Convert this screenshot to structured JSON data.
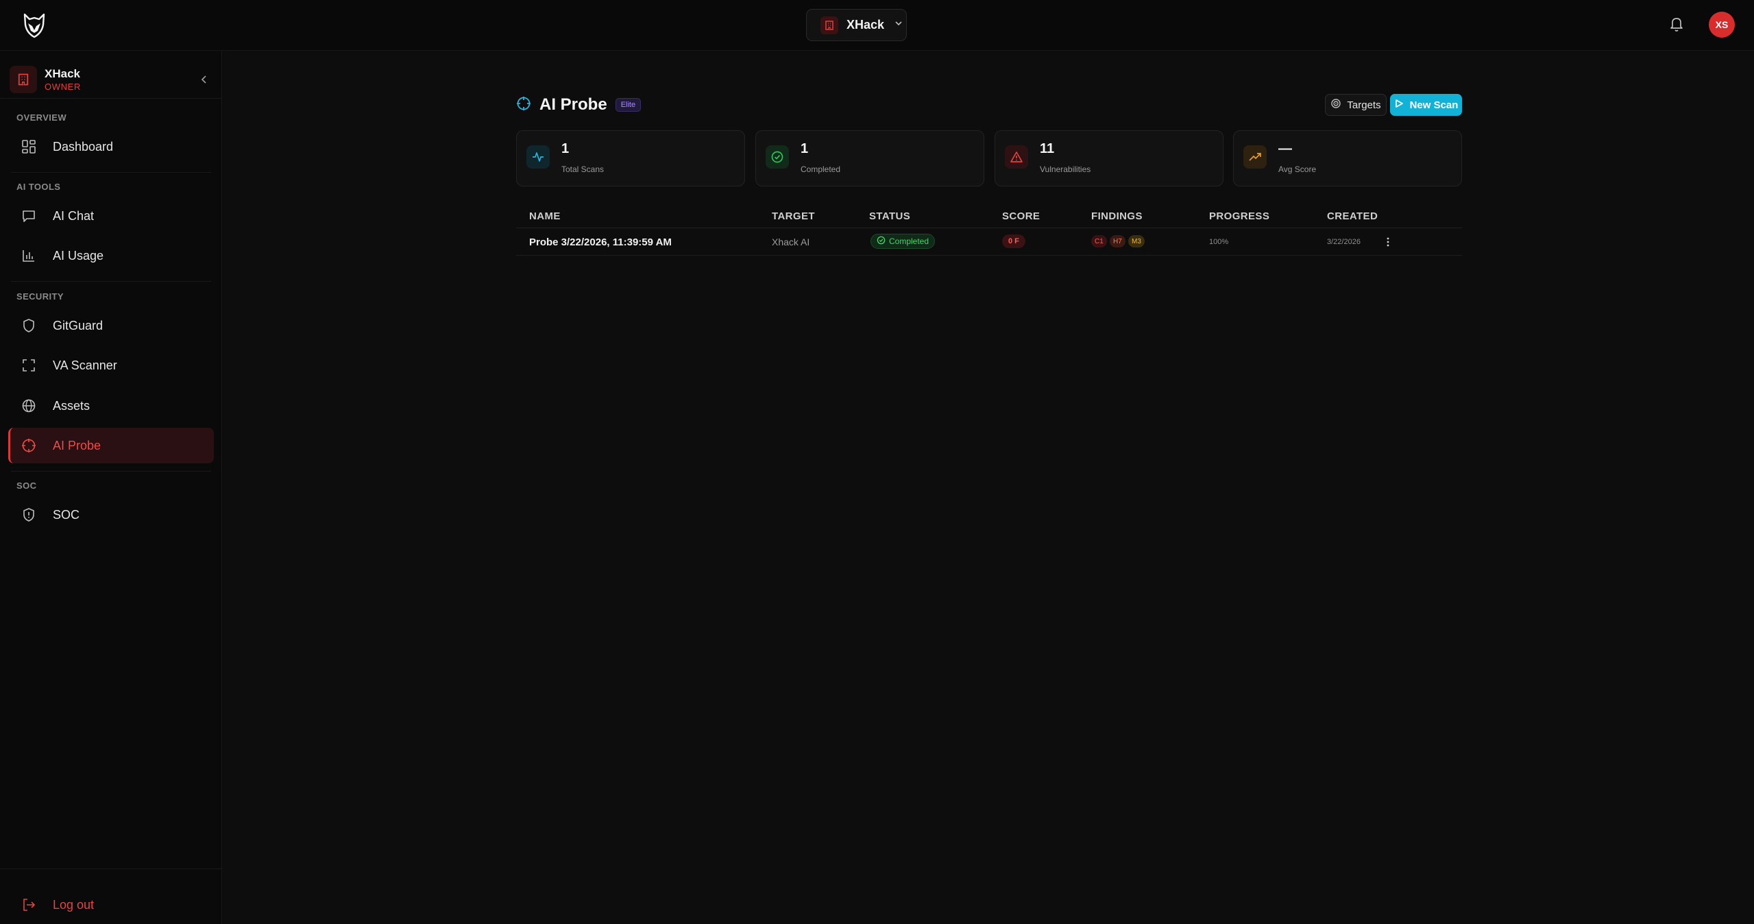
{
  "header": {
    "org_switcher_label": "XHack",
    "avatar_initials": "XS"
  },
  "sidebar": {
    "workspace_name": "XHack",
    "workspace_role": "OWNER",
    "sections": {
      "overview": "OVERVIEW",
      "ai_tools": "AI TOOLS",
      "security": "SECURITY",
      "soc": "SOC"
    },
    "items": {
      "dashboard": "Dashboard",
      "ai_chat": "AI Chat",
      "ai_usage": "AI Usage",
      "gitguard": "GitGuard",
      "va_scanner": "VA Scanner",
      "assets": "Assets",
      "ai_probe": "AI Probe",
      "soc": "SOC"
    },
    "logout_label": "Log out"
  },
  "page": {
    "title": "AI Probe",
    "tier_badge": "Elite",
    "targets_button": "Targets",
    "new_scan_button": "New Scan"
  },
  "stats": [
    {
      "value": "1",
      "caption": "Total Scans",
      "icon": "activity-icon",
      "color": "#2bb3d9"
    },
    {
      "value": "1",
      "caption": "Completed",
      "icon": "check-circle-icon",
      "color": "#2fc35a"
    },
    {
      "value": "11",
      "caption": "Vulnerabilities",
      "icon": "warning-triangle-icon",
      "color": "#e0413f"
    },
    {
      "value": "—",
      "caption": "Avg Score",
      "icon": "trending-up-icon",
      "color": "#e89b2a"
    }
  ],
  "table": {
    "columns": [
      "NAME",
      "TARGET",
      "STATUS",
      "SCORE",
      "FINDINGS",
      "PROGRESS",
      "CREATED"
    ],
    "rows": [
      {
        "name": "Probe 3/22/2026, 11:39:59 AM",
        "target": "Xhack AI",
        "status": "Completed",
        "score": "0 F",
        "findings": {
          "critical": "C1",
          "high": "H7",
          "medium": "M3"
        },
        "progress": "100%",
        "created": "3/22/2026"
      }
    ]
  },
  "colors": {
    "accent_red": "#e0413f",
    "accent_cyan": "#12b2d6",
    "success_green": "#46d46b"
  }
}
